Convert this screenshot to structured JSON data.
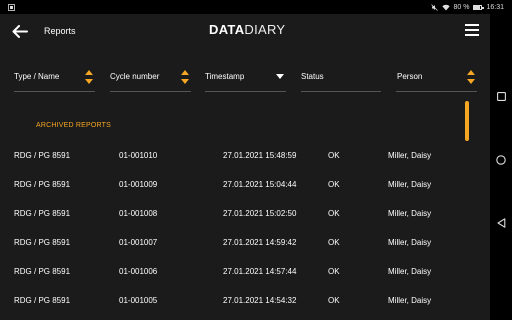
{
  "status_bar": {
    "battery_text": "80 %",
    "battery_level": 0.8,
    "time": "16:31"
  },
  "header": {
    "title": "Reports",
    "logo_bold": "DATA",
    "logo_light": "DIARY"
  },
  "columns": [
    {
      "label": "Type / Name",
      "sort": "both"
    },
    {
      "label": "Cycle number",
      "sort": "both"
    },
    {
      "label": "Timestamp",
      "sort": "down-active"
    },
    {
      "label": "Status",
      "sort": "none"
    },
    {
      "label": "Person",
      "sort": "both"
    }
  ],
  "section": {
    "label": "ARCHIVED REPORTS"
  },
  "rows": [
    {
      "type": "RDG / PG 8591",
      "cycle": "01-001010",
      "timestamp": "27.01.2021 15:48:59",
      "status": "OK",
      "person": "Miller, Daisy"
    },
    {
      "type": "RDG / PG 8591",
      "cycle": "01-001009",
      "timestamp": "27.01.2021 15:04:44",
      "status": "OK",
      "person": "Miller, Daisy"
    },
    {
      "type": "RDG / PG 8591",
      "cycle": "01-001008",
      "timestamp": "27.01.2021 15:02:50",
      "status": "OK",
      "person": "Miller, Daisy"
    },
    {
      "type": "RDG / PG 8591",
      "cycle": "01-001007",
      "timestamp": "27.01.2021 14:59:42",
      "status": "OK",
      "person": "Miller, Daisy"
    },
    {
      "type": "RDG / PG 8591",
      "cycle": "01-001006",
      "timestamp": "27.01.2021 14:57:44",
      "status": "OK",
      "person": "Miller, Daisy"
    },
    {
      "type": "RDG / PG 8591",
      "cycle": "01-001005",
      "timestamp": "27.01.2021 14:54:32",
      "status": "OK",
      "person": "Miller, Daisy"
    }
  ],
  "colors": {
    "accent": "#f5a623",
    "background": "#1b1b1b"
  },
  "icons": {
    "back": "arrow-left-icon",
    "menu": "hamburger-menu-icon",
    "nav_square": "square-icon",
    "nav_circle": "circle-icon",
    "nav_triangle": "triangle-back-icon"
  }
}
